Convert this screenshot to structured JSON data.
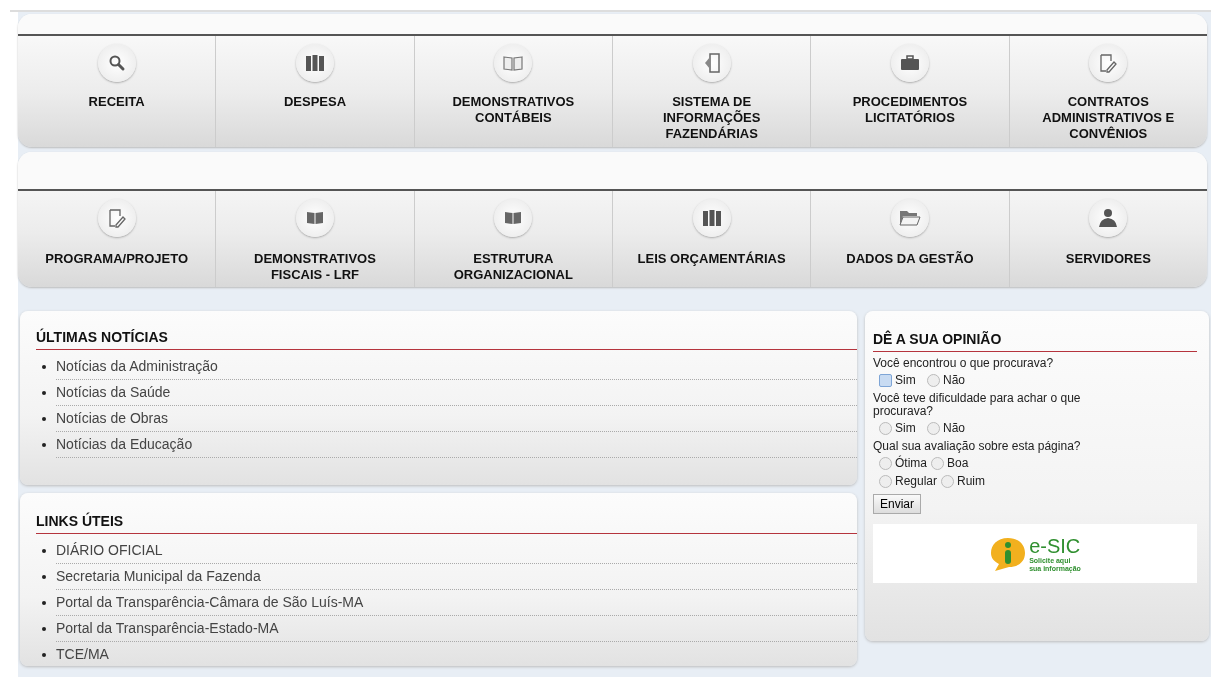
{
  "menus": [
    {
      "items": [
        {
          "label": "RECEITA"
        },
        {
          "label": "DESPESA"
        },
        {
          "label": "DEMONSTRATIVOS CONTÁBEIS"
        },
        {
          "label": "SISTEMA DE INFORMAÇÕES FAZENDÁRIAS"
        },
        {
          "label": "PROCEDIMENTOS LICITATÓRIOS"
        },
        {
          "label": "CONTRATOS ADMINISTRATIVOS E CONVÊNIOS"
        }
      ]
    },
    {
      "items": [
        {
          "label": "PROGRAMA/PROJETO"
        },
        {
          "label": "DEMONSTRATIVOS FISCAIS - LRF"
        },
        {
          "label": "ESTRUTURA ORGANIZACIONAL"
        },
        {
          "label": "LEIS ORÇAMENTÁRIAS"
        },
        {
          "label": "DADOS DA GESTÃO"
        },
        {
          "label": "SERVIDORES"
        }
      ]
    }
  ],
  "news": {
    "title": "ÚLTIMAS NOTÍCIAS",
    "items": [
      "Notícias da Administração",
      "Notícias da Saúde",
      "Notícias de Obras",
      "Notícias da Educação"
    ]
  },
  "links": {
    "title": "LINKS ÚTEIS",
    "items": [
      "DIÁRIO OFICIAL",
      "Secretaria Municipal da Fazenda",
      "Portal da Transparência-Câmara de São Luís-MA",
      "Portal da Transparência-Estado-MA",
      "TCE/MA"
    ]
  },
  "poll": {
    "title": "DÊ A SUA OPINIÃO",
    "questions": [
      {
        "text": "Você encontrou o que procurava?",
        "rows": [
          [
            {
              "label": "Sim",
              "selected": false,
              "focused": true
            },
            {
              "label": "Não",
              "selected": false,
              "focused": false
            }
          ]
        ]
      },
      {
        "text": "Você teve dificuldade para achar o que procurava?",
        "rows": [
          [
            {
              "label": "Sim",
              "selected": false,
              "focused": false
            },
            {
              "label": "Não",
              "selected": false,
              "focused": false
            }
          ]
        ]
      },
      {
        "text": "Qual sua avaliação sobre esta página?",
        "rows": [
          [
            {
              "label": "Ótima",
              "selected": false,
              "focused": false
            },
            {
              "label": "Boa",
              "selected": false,
              "focused": false
            }
          ],
          [
            {
              "label": "Regular",
              "selected": false,
              "focused": false
            },
            {
              "label": "Ruim",
              "selected": false,
              "focused": false
            }
          ]
        ]
      }
    ],
    "button": "Enviar",
    "banner": {
      "name": "e-SIC",
      "line1": "Solicite aqui",
      "line2": "sua informação"
    }
  }
}
